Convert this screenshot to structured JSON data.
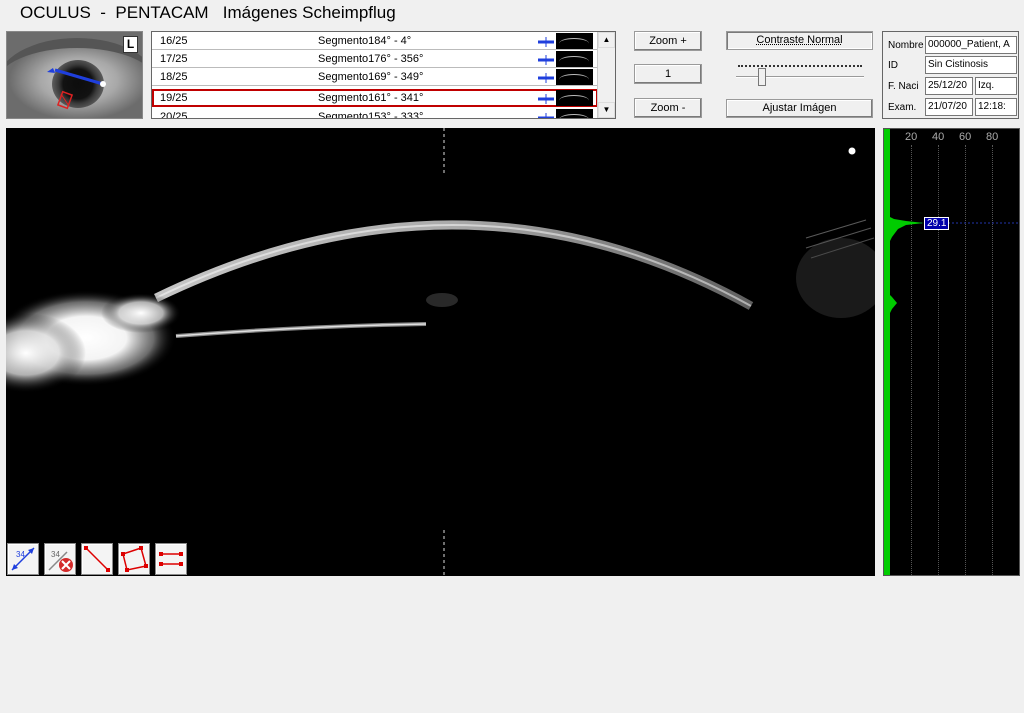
{
  "title": "OCULUS  -  PENTACAM   Imágenes Scheimpflug",
  "eye": {
    "side_label": "L"
  },
  "segments": [
    {
      "num": "16/25",
      "label": "Segmento184° - 4°"
    },
    {
      "num": "17/25",
      "label": "Segmento176° - 356°"
    },
    {
      "num": "18/25",
      "label": "Segmento169° - 349°"
    },
    {
      "num": "19/25",
      "label": "Segmento161° - 341°"
    },
    {
      "num": "20/25",
      "label": "Segmento153° - 333°"
    }
  ],
  "selected_segment_index": 3,
  "buttons": {
    "zoom_in": "Zoom +",
    "zoom_level": "1",
    "zoom_out": "Zoom -",
    "contrast": "Contraste Normal",
    "adjust": "Ajustar Imágen"
  },
  "patient": {
    "name_label": "Nombre",
    "name_value": "000000_Patient, A",
    "id_label": "ID",
    "id_value": "Sin Cistinosis",
    "dob_label": "F. Naci",
    "dob_value": "25/12/20",
    "eye_value": "Izq.",
    "exam_label": "Exam.",
    "exam_date": "21/07/20",
    "exam_time": "12:18:"
  },
  "density": {
    "scale_labels": [
      "20",
      "40",
      "60",
      "80"
    ],
    "value_label": "29.1",
    "colors": {
      "curve": "#00cc00",
      "marker": "#0000aa"
    }
  },
  "tools": [
    "measure-distance-tool",
    "delete-measurement-tool",
    "line-tool",
    "polygon-tool",
    "thickness-tool"
  ],
  "colors": {
    "selection": "#c00000",
    "accent_blue": "#0044cc"
  }
}
